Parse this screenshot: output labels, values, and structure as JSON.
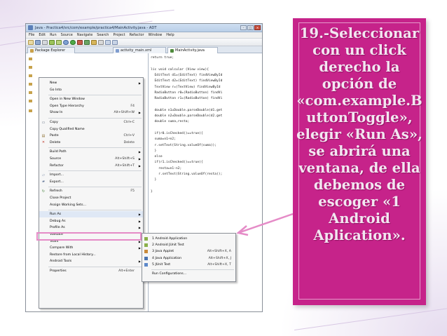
{
  "window": {
    "title": "Java - Practica4/src/com/example/practica4/MainActivity.java - ADT",
    "controls": [
      "–",
      "□",
      "✕"
    ]
  },
  "menubar": [
    "File",
    "Edit",
    "Run",
    "Source",
    "Navigate",
    "Search",
    "Project",
    "Refactor",
    "Window",
    "Help"
  ],
  "tabs": {
    "package_explorer": "Package Explorer",
    "activity_xml": "activity_main.xml",
    "main_java": "MainActivity.java"
  },
  "code": [
    "return true;",
    "",
    "lic void calcular (View view){",
    "  EditText d1=(EditText) findViewById",
    "  EditText d2=(EditText) findViewById",
    "  TextView r=(TextView) findViewById",
    "  RadioButton r0=(RadioButton) findVi",
    "  RadioButton r1=(RadioButton) findVi",
    "",
    "  double n1=Double.parseDouble(d1.get",
    "  double n2=Double.parseDouble(d2.get",
    "  double suma,resta;",
    "",
    "  if(r0.isChecked()==true){",
    "  suma=n1+n2;",
    "  r.setText(String.valueOf(suma));",
    "  }",
    "  else",
    "  if(r1.isChecked()==true){",
    "    resta=n1-n2;",
    "    r.setText(String.valueOf(resta));",
    "  }",
    "",
    "}"
  ],
  "context_menu": [
    {
      "label": "New",
      "shortcut": "",
      "submenu": true
    },
    {
      "label": "Go Into",
      "shortcut": "",
      "submenu": false
    },
    {
      "sep": true
    },
    {
      "label": "Open in New Window",
      "shortcut": "",
      "submenu": false
    },
    {
      "label": "Open Type Hierarchy",
      "shortcut": "F4",
      "submenu": false
    },
    {
      "label": "Show In",
      "shortcut": "Alt+Shift+W",
      "submenu": true
    },
    {
      "sep": true
    },
    {
      "label": "Copy",
      "shortcut": "Ctrl+C",
      "submenu": false
    },
    {
      "label": "Copy Qualified Name",
      "shortcut": "",
      "submenu": false
    },
    {
      "label": "Paste",
      "shortcut": "Ctrl+V",
      "submenu": false
    },
    {
      "label": "Delete",
      "shortcut": "Delete",
      "submenu": false
    },
    {
      "sep": true
    },
    {
      "label": "Build Path",
      "shortcut": "",
      "submenu": true
    },
    {
      "label": "Source",
      "shortcut": "Alt+Shift+S",
      "submenu": true
    },
    {
      "label": "Refactor",
      "shortcut": "Alt+Shift+T",
      "submenu": true
    },
    {
      "sep": true
    },
    {
      "label": "Import...",
      "shortcut": "",
      "submenu": false
    },
    {
      "label": "Export...",
      "shortcut": "",
      "submenu": false
    },
    {
      "sep": true
    },
    {
      "label": "Refresh",
      "shortcut": "F5",
      "submenu": false
    },
    {
      "label": "Close Project",
      "shortcut": "",
      "submenu": false
    },
    {
      "label": "Assign Working Sets...",
      "shortcut": "",
      "submenu": false
    },
    {
      "sep": true
    },
    {
      "label": "Run As",
      "shortcut": "",
      "submenu": true,
      "active": true
    },
    {
      "label": "Debug As",
      "shortcut": "",
      "submenu": true
    },
    {
      "label": "Profile As",
      "shortcut": "",
      "submenu": true
    },
    {
      "label": "Validate",
      "shortcut": "",
      "submenu": false
    },
    {
      "label": "Team",
      "shortcut": "",
      "submenu": true
    },
    {
      "label": "Compare With",
      "shortcut": "",
      "submenu": true
    },
    {
      "label": "Restore from Local History...",
      "shortcut": "",
      "submenu": false
    },
    {
      "label": "Android Tools",
      "shortcut": "",
      "submenu": true
    },
    {
      "sep": true
    },
    {
      "label": "Properties",
      "shortcut": "Alt+Enter",
      "submenu": false
    }
  ],
  "run_as_submenu": [
    {
      "label": "1 Android Application",
      "shortcut": ""
    },
    {
      "label": "2 Android JUnit Test",
      "shortcut": ""
    },
    {
      "label": "3 Java Applet",
      "shortcut": "Alt+Shift+X, A"
    },
    {
      "label": "4 Java Application",
      "shortcut": "Alt+Shift+X, J"
    },
    {
      "label": "5 JUnit Test",
      "shortcut": "Alt+Shift+X, T"
    },
    {
      "sep": true
    },
    {
      "label": "Run Configurations...",
      "shortcut": ""
    }
  ],
  "instruction": {
    "text": "19.-Seleccionar con un click derecho la opción de «com.example.ButtonToggle», elegir «Run As», se abrirá una ventana, de ella debemos de escoger «1 Android Aplication»."
  },
  "colors": {
    "panel": "#c6238a",
    "panel_text": "#f3e6f1",
    "highlight": "#e58bc7"
  }
}
